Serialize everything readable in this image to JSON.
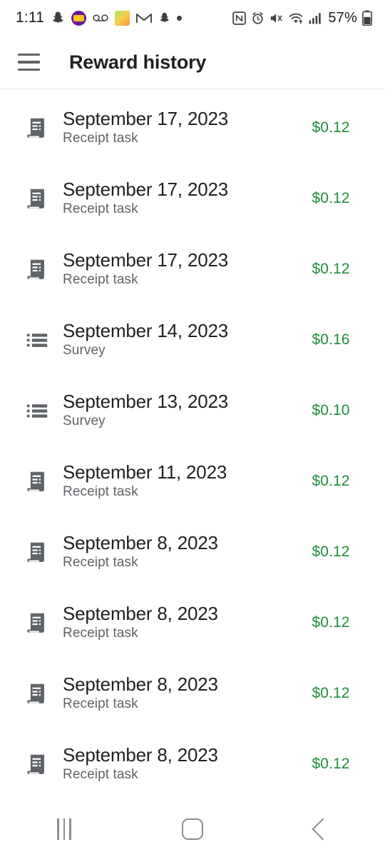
{
  "status_bar": {
    "time": "1:11",
    "battery_percent": "57%",
    "left_icons": [
      "snapchat-ghost-icon",
      "purple-app-icon",
      "voicemail-icon",
      "colorful-app-icon",
      "gmail-icon",
      "snapchat-icon",
      "more-notifications-dot-icon"
    ],
    "right_icons": [
      "nfc-icon",
      "alarm-icon",
      "mute-icon",
      "wifi-icon",
      "cellular-signal-icon",
      "battery-icon"
    ]
  },
  "app_bar": {
    "menu_icon": "hamburger-menu-icon",
    "title": "Reward history"
  },
  "colors": {
    "amount_green": "#1e8e3e",
    "title_text": "#202124",
    "subtitle_text": "#5f6368",
    "divider": "#e9eaec",
    "background": "#ffffff"
  },
  "rewards": [
    {
      "date": "September 17, 2023",
      "type": "Receipt task",
      "amount": "$0.12",
      "icon": "receipt-icon"
    },
    {
      "date": "September 17, 2023",
      "type": "Receipt task",
      "amount": "$0.12",
      "icon": "receipt-icon"
    },
    {
      "date": "September 17, 2023",
      "type": "Receipt task",
      "amount": "$0.12",
      "icon": "receipt-icon"
    },
    {
      "date": "September 14, 2023",
      "type": "Survey",
      "amount": "$0.16",
      "icon": "list-icon"
    },
    {
      "date": "September 13, 2023",
      "type": "Survey",
      "amount": "$0.10",
      "icon": "list-icon"
    },
    {
      "date": "September 11, 2023",
      "type": "Receipt task",
      "amount": "$0.12",
      "icon": "receipt-icon"
    },
    {
      "date": "September 8, 2023",
      "type": "Receipt task",
      "amount": "$0.12",
      "icon": "receipt-icon"
    },
    {
      "date": "September 8, 2023",
      "type": "Receipt task",
      "amount": "$0.12",
      "icon": "receipt-icon"
    },
    {
      "date": "September 8, 2023",
      "type": "Receipt task",
      "amount": "$0.12",
      "icon": "receipt-icon"
    },
    {
      "date": "September 8, 2023",
      "type": "Receipt task",
      "amount": "$0.12",
      "icon": "receipt-icon"
    }
  ],
  "nav_bar": {
    "recents_label": "recents-icon",
    "home_label": "home-icon",
    "back_label": "back-icon"
  }
}
